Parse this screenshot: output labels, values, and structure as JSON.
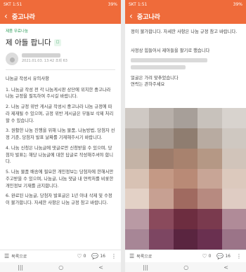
{
  "status": {
    "left": "SKT 1:51",
    "battery": "39%"
  },
  "appbar": {
    "back_glyph": "‹",
    "title": "중고나라"
  },
  "post": {
    "category": "제품 무료나눔",
    "title": "제 아들 팝니다",
    "meta": "2021.01.03. 13:42 조회 63"
  },
  "body": {
    "notice_title": "나눔글 작성시 유의사항",
    "items": [
      "1. 나눔글 작성 전 각 나눔게시판 상단에 위치한 중고나라 나눔 규정을 필독하여 주시길 바랍니다.",
      "2. 나눔 규정 위반 게시글 작성시 중고나라 나눔 규정에 따라 제재될 수 있으며, 규정 위반 게시글은 무통보 삭제 처리할 수 있습니다.",
      "3. 원활한 나눔 진행을 위해 나눔 물품, 나눔방법, 당첨자 선정 기준, 당첨자 발표 날짜를 기재해주시기 바랍니다.",
      "4. 나눔 신청은 나눔글에 댓글로만 신청받을 수 있으며, 당첨자 발표는 해당 나눔글에 대한 답글로 작성해주셔야 합니다.",
      "5. 나눔 물품 배송에 필요한 개인정보는 당첨자에 한해서만 주고받을 수 있으며, 나눔글, 나눔 댓글 내 연락처를 비롯한 개인정보 기재를 금지합니다.",
      "6. 완료된 나눔글, 당첨자 발표글은 1년 이내 삭제 및 수정이 불가합니다. 자세한 사항은 나눔 규정 참고 바랍니다."
    ]
  },
  "right": {
    "top_text": "정이 불가합니다. 자세한 사항은 나눔 규정 참고 바랍니다.",
    "line1": "사정상 힘들어서 제아들을 팔기로 했습니다",
    "line2": "얼굴은 가려 맞추었습니다",
    "line3": "연락는 관하주세요"
  },
  "bottom": {
    "list_label": "목록으로",
    "like_count": "0",
    "comment_count": "16"
  },
  "nav": {
    "recent": "|||",
    "home": "○",
    "back": "<"
  },
  "colors": {
    "brand": "#ef6b3a",
    "category": "#2e9d5a"
  },
  "mosaic": {
    "cells": [
      "#cfc9c4",
      "#b8b0aa",
      "#a79f99",
      "#c8c2bc",
      "#d8d3ce",
      "#bdb4ad",
      "#a2948a",
      "#8f7d70",
      "#b8aba1",
      "#cfc8c1",
      "#c4b3a6",
      "#9c7b6a",
      "#a8826e",
      "#b59885",
      "#d1c4ba",
      "#d8c2b4",
      "#c49985",
      "#b98a76",
      "#c8a596",
      "#dcc9bd",
      "#e3d1c6",
      "#c7a092",
      "#a06a60",
      "#b78a80",
      "#dfccc3",
      "#b99aa4",
      "#8a4a5c",
      "#6d2d40",
      "#7a3a4e",
      "#b08b98",
      "#a78696",
      "#7d4662",
      "#5a2540",
      "#6a3050",
      "#9b7488"
    ]
  }
}
